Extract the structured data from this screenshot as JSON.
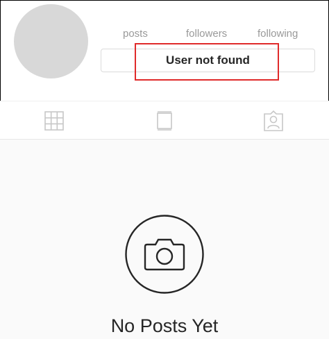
{
  "profile": {
    "stats": {
      "posts_label": "posts",
      "followers_label": "followers",
      "following_label": "following"
    },
    "button_label": "User not found",
    "highlight_color": "#e02a2a"
  },
  "tabs": [
    {
      "icon": "grid-icon"
    },
    {
      "icon": "feed-icon"
    },
    {
      "icon": "tagged-icon"
    }
  ],
  "empty_state": {
    "icon": "camera-icon",
    "title": "No Posts Yet"
  }
}
